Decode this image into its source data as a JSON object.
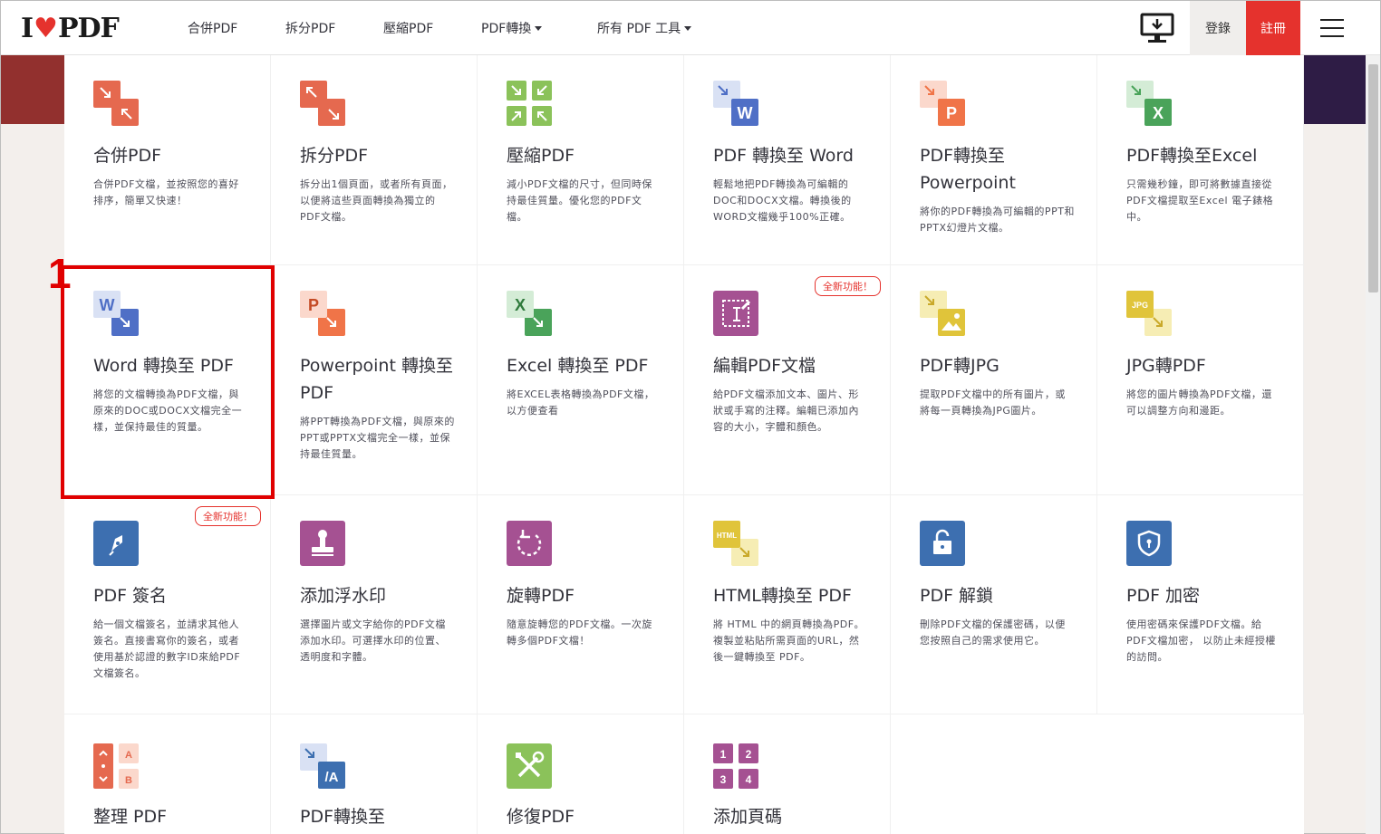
{
  "nav": {
    "logo_left": "I",
    "logo_right": "PDF",
    "items": [
      "合併PDF",
      "拆分PDF",
      "壓縮PDF",
      "PDF轉換",
      "所有 PDF 工具"
    ],
    "login": "登錄",
    "signup": "註冊"
  },
  "annotation": "1",
  "badge_text": "全新功能！",
  "tools": [
    {
      "title": "合併PDF",
      "desc": "合併PDF文檔，並按照您的喜好排序，簡單又快速！"
    },
    {
      "title": "拆分PDF",
      "desc": "拆分出1個頁面，或者所有頁面，以便將這些頁面轉換為獨立的PDF文檔。"
    },
    {
      "title": "壓縮PDF",
      "desc": "減小PDF文檔的尺寸，但同時保持最佳質量。優化您的PDF文檔。"
    },
    {
      "title": "PDF 轉換至 Word",
      "desc": "輕鬆地把PDF轉換為可編輯的DOC和DOCX文檔。轉換後的WORD文檔幾乎100%正確。"
    },
    {
      "title": "PDF轉換至 Powerpoint",
      "desc": "將你的PDF轉換為可編輯的PPT和PPTX幻燈片文檔。"
    },
    {
      "title": "PDF轉換至Excel",
      "desc": "只需幾秒鐘，即可將數據直接從PDF文檔提取至Excel 電子錶格中。"
    },
    {
      "title": "Word 轉換至 PDF",
      "desc": "將您的文檔轉換為PDF文檔，與原來的DOC或DOCX文檔完全一樣，並保持最佳的質量。"
    },
    {
      "title": "Powerpoint 轉換至 PDF",
      "desc": "將PPT轉換為PDF文檔，與原來的PPT或PPTX文檔完全一樣，並保持最佳質量。"
    },
    {
      "title": "Excel 轉換至 PDF",
      "desc": "將EXCEL表格轉換為PDF文檔，以方便查看"
    },
    {
      "title": "編輯PDF文檔",
      "desc": "給PDF文檔添加文本、圖片、形狀或手寫的注釋。編輯已添加內容的大小，字體和顏色。"
    },
    {
      "title": "PDF轉JPG",
      "desc": "提取PDF文檔中的所有圖片，或將每一頁轉換為JPG圖片。"
    },
    {
      "title": "JPG轉PDF",
      "desc": "將您的圖片轉換為PDF文檔，還可以調整方向和邊距。"
    },
    {
      "title": "PDF 簽名",
      "desc": "給一個文檔簽名，並請求其他人簽名。直接書寫你的簽名，或者使用基於認證的數字ID來給PDF文檔簽名。"
    },
    {
      "title": "添加浮水印",
      "desc": "選擇圖片或文字給你的PDF文檔添加水印。可選擇水印的位置、透明度和字體。"
    },
    {
      "title": "旋轉PDF",
      "desc": "隨意旋轉您的PDF文檔。一次旋轉多個PDF文檔！"
    },
    {
      "title": "HTML轉換至 PDF",
      "desc": "將 HTML 中的網頁轉換為PDF。複製並粘貼所需頁面的URL，然後一鍵轉換至 PDF。"
    },
    {
      "title": "PDF 解鎖",
      "desc": "刪除PDF文檔的保護密碼，以便您按照自己的需求使用它。"
    },
    {
      "title": "PDF 加密",
      "desc": "使用密碼來保護PDF文檔。給PDF文檔加密， 以防止未經授權的訪問。"
    },
    {
      "title": "整理 PDF",
      "desc": ""
    },
    {
      "title": "PDF轉換至",
      "desc": ""
    },
    {
      "title": "修復PDF",
      "desc": ""
    },
    {
      "title": "添加頁碼",
      "desc": ""
    }
  ],
  "icon_labels": {
    "word": "W",
    "powerpoint": "P",
    "excel": "X",
    "jpg": "JPG",
    "html": "HTML",
    "pdfa": "/A",
    "a": "A",
    "b": "B",
    "n1": "1",
    "n2": "2",
    "n3": "3",
    "n4": "4"
  },
  "colors": {
    "brand_red": "#e5322d",
    "merge": "#e5694f",
    "compress": "#8bc25a",
    "word": "#4f6fc6",
    "powerpoint": "#f07448",
    "excel": "#4aa35a",
    "edit": "#a55192",
    "jpg": "#e0c43a",
    "sign": "#3d6fb0",
    "watermark": "#a55192",
    "rotate": "#a55192",
    "html": "#e0c43a",
    "lock": "#3d6fb0"
  }
}
